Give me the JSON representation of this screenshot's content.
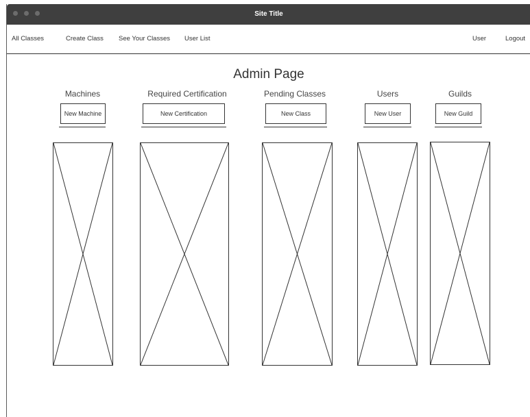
{
  "window": {
    "title": "Site Title"
  },
  "nav": {
    "all_classes": "All Classes",
    "create_class": "Create Class",
    "see_your_classes": "See Your Classes",
    "user_list": "User List",
    "user": "User",
    "logout": "Logout"
  },
  "main": {
    "title": "Admin Page",
    "columns": [
      {
        "title": "Machines",
        "button": "New Machine"
      },
      {
        "title": "Required Certification",
        "button": "New Certification"
      },
      {
        "title": "Pending Classes",
        "button": "New Class"
      },
      {
        "title": "Users",
        "button": "New User"
      },
      {
        "title": "Guilds",
        "button": "New Guild"
      }
    ]
  }
}
